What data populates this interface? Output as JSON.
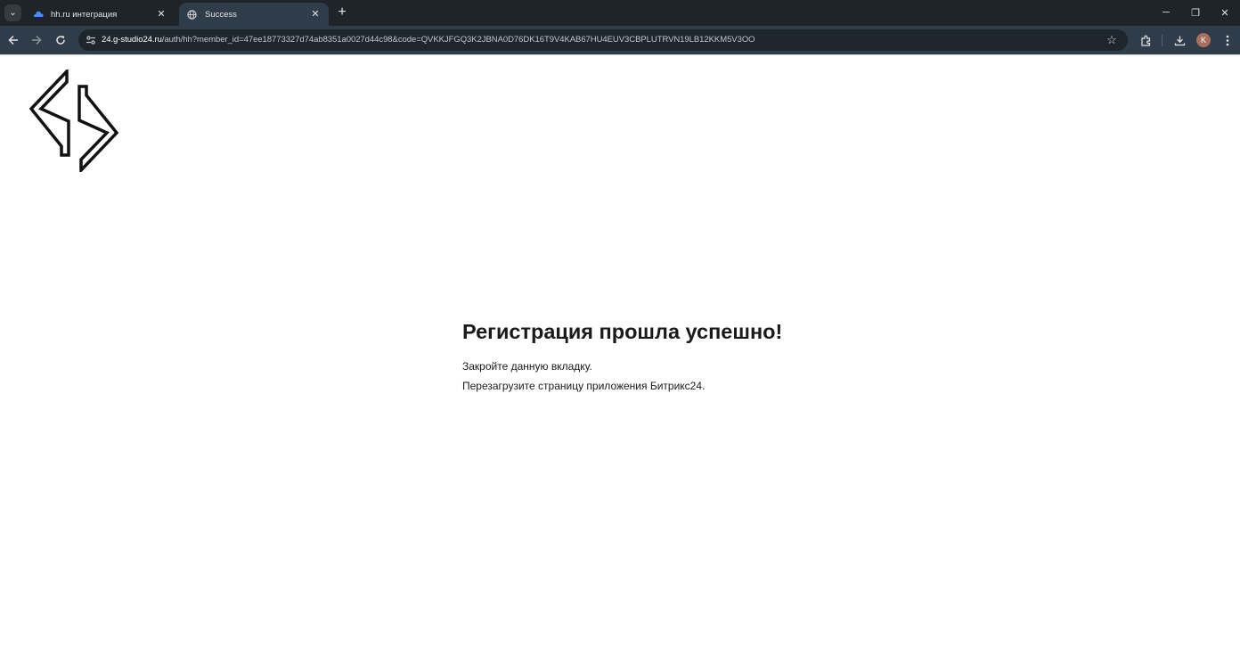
{
  "browser": {
    "tabs": [
      {
        "title": "hh.ru интеграция",
        "active": false
      },
      {
        "title": "Success",
        "active": true
      }
    ],
    "address_host": "24.g-studio24.ru",
    "address_path": "/auth/hh?member_id=47ee18773327d74ab8351a0027d44c98&code=QVKKJFGQ3K2JBNA0D76DK16T9V4KAB67HU4EUV3CBPLUTRVN19LB12KKM5V3OO",
    "profile_initial": "K",
    "colors": {
      "tabstrip": "#1f2428",
      "toolbar": "#2f3c49",
      "omnibox": "#1e252c"
    }
  },
  "page": {
    "heading": "Регистрация прошла успешно!",
    "line1": "Закройте данную вкладку.",
    "line2": "Перезагрузите страницу приложения Битрикс24."
  }
}
